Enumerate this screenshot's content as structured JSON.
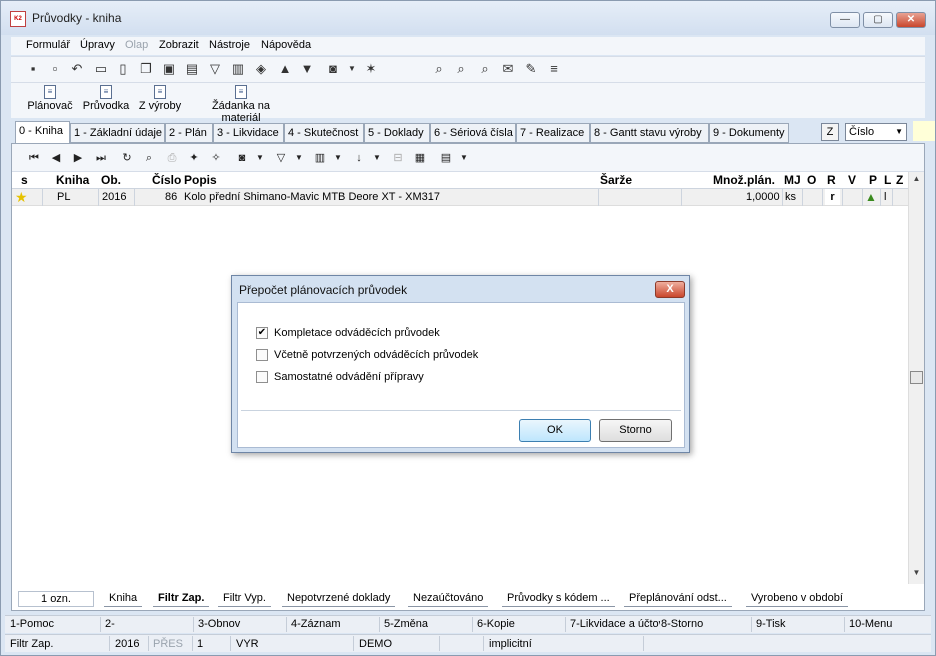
{
  "window": {
    "title": "Průvodky - kniha",
    "app_icon": "K2"
  },
  "menu": [
    "Formulář",
    "Úpravy",
    "Olap",
    "Zobrazit",
    "Nástroje",
    "Nápověda"
  ],
  "ribbon": [
    "Plánovač",
    "Průvodka",
    "Z výroby",
    "Žádanka na materiál"
  ],
  "tabs": [
    "0 - Kniha",
    "1 - Základní údaje",
    "2 - Plán",
    "3 - Likvidace",
    "4 - Skutečnost",
    "5 - Doklady",
    "6 - Sériová čísla",
    "7 - Realizace",
    "8 - Gantt stavu výroby",
    "9 - Dokumenty"
  ],
  "sort": {
    "z_label": "Z",
    "field": "Číslo"
  },
  "grid": {
    "headers": {
      "s": "s",
      "kniha": "Kniha",
      "ob": "Ob.",
      "cislo": "Číslo",
      "popis": "Popis",
      "sarze": "Šarže",
      "mnoz": "Množ.plán.",
      "mj": "MJ",
      "o": "O",
      "r": "R",
      "v": "V",
      "p": "P",
      "l": "L",
      "z": "Z"
    },
    "row": {
      "kniha": "PL",
      "ob": "2016",
      "cislo": "86",
      "popis": "Kolo přední Shimano-Mavic MTB Deore XT - XM317",
      "mnoz": "1,0000",
      "mj": "ks",
      "r": "r",
      "l": "l"
    }
  },
  "bottom_tabs": {
    "count": "1 ozn.",
    "items": [
      "Kniha",
      "Filtr Zap.",
      "Filtr Vyp.",
      "Nepotvrzené doklady",
      "Nezaúčtováno",
      "Průvodky s kódem ...",
      "Přeplánování odst...",
      "Vyrobeno v období"
    ]
  },
  "fkeys": [
    "1-Pomoc",
    "2-",
    "3-Obnov",
    "4-Záznam",
    "5-Změna",
    "6-Kopie",
    "7-Likvidace a účtov",
    "8-Storno",
    "9-Tisk",
    "10-Menu"
  ],
  "status": [
    "Filtr Zap.",
    "2016",
    "PŘES",
    "1",
    "VYR",
    "DEMO",
    "implicitní"
  ],
  "dialog": {
    "title": "Přepočet plánovacích průvodek",
    "options": [
      {
        "label": "Kompletace odváděcích průvodek",
        "checked": true
      },
      {
        "label": "Včetně potvrzených odváděcích průvodek",
        "checked": false
      },
      {
        "label": "Samostatné odvádění přípravy",
        "checked": false
      }
    ],
    "ok": "OK",
    "cancel": "Storno",
    "close": "X"
  }
}
